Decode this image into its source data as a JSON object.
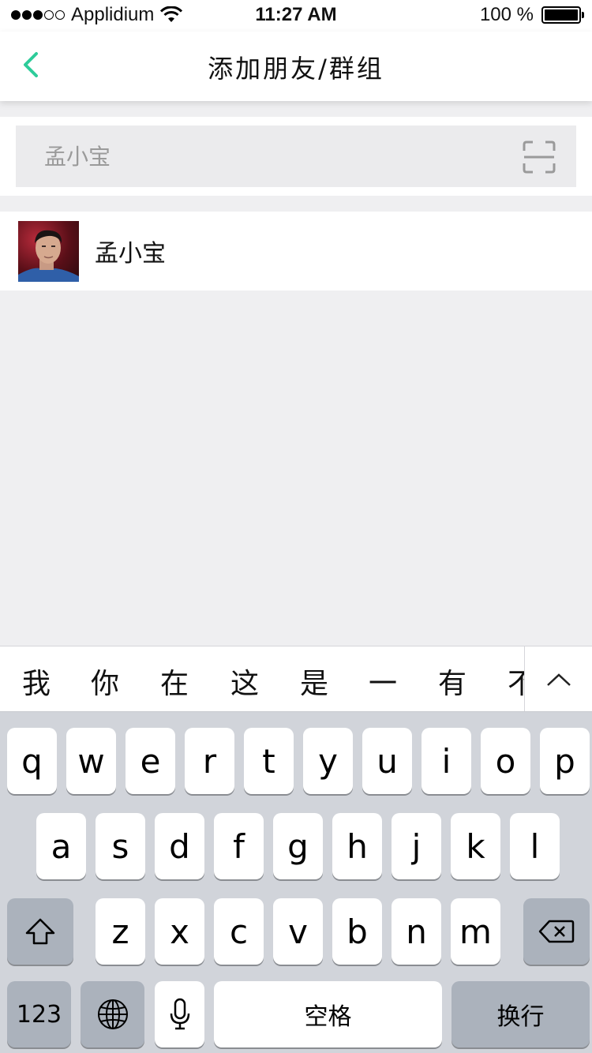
{
  "status_bar": {
    "carrier": "Applidium",
    "time": "11:27 AM",
    "battery": "100 %",
    "signal_icon": "signal-dots-icon",
    "wifi_icon": "wifi-icon",
    "battery_icon": "battery-icon"
  },
  "nav": {
    "title": "添加朋友/群组",
    "back_icon": "chevron-left-icon"
  },
  "search": {
    "value": "孟小宝",
    "scan_icon": "scan-icon"
  },
  "results": [
    {
      "name": "孟小宝",
      "avatar": "avatar-photo"
    }
  ],
  "keyboard": {
    "candidates": [
      "我",
      "你",
      "在",
      "这",
      "是",
      "一",
      "有",
      "不"
    ],
    "row1": [
      "q",
      "w",
      "e",
      "r",
      "t",
      "y",
      "u",
      "i",
      "o",
      "p"
    ],
    "row2": [
      "a",
      "s",
      "d",
      "f",
      "g",
      "h",
      "j",
      "k",
      "l"
    ],
    "row3": [
      "z",
      "x",
      "c",
      "v",
      "b",
      "n",
      "m"
    ],
    "numbers_label": "123",
    "space_label": "空格",
    "return_label": "换行"
  },
  "colors": {
    "accent": "#2ecc9a",
    "background": "#efeff1",
    "keyboard_bg": "#d1d4da"
  }
}
